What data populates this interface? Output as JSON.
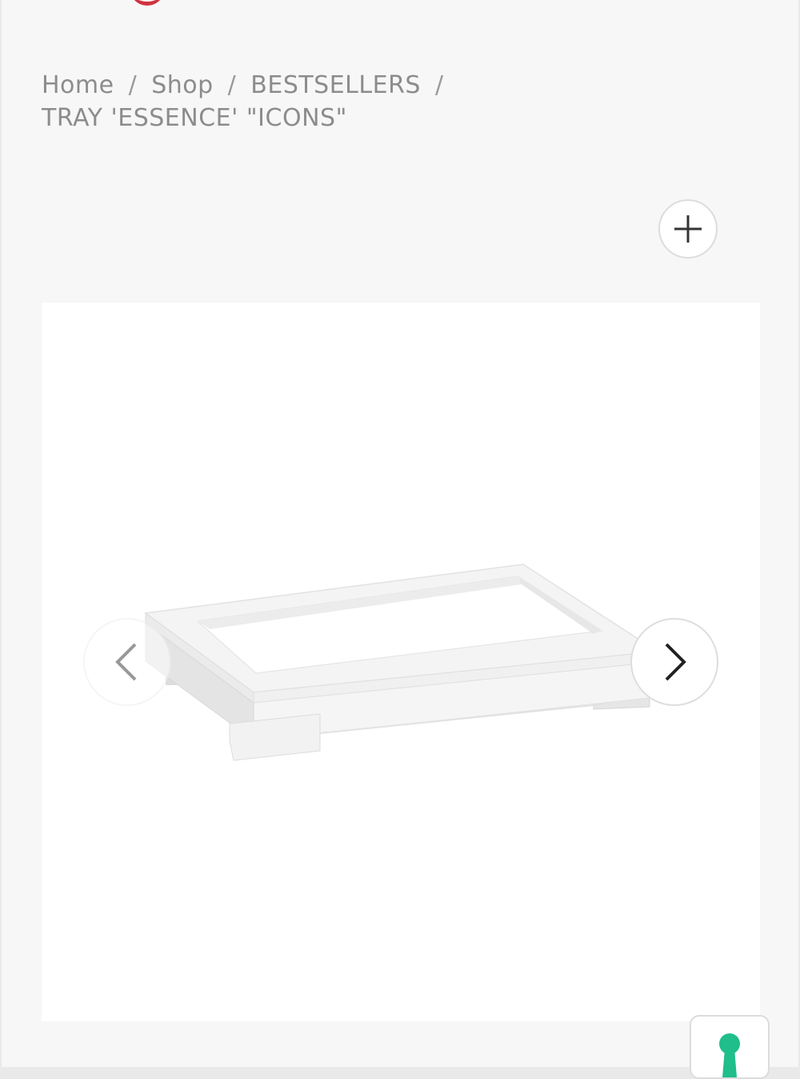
{
  "breadcrumb": {
    "items": [
      "Home",
      "Shop",
      "BESTSELLERS"
    ],
    "separator": "/",
    "current": "TRAY 'ESSENCE' \"ICONS\""
  },
  "icons": {
    "zoom": "plus-icon",
    "prev": "chevron-left-icon",
    "next": "chevron-right-icon",
    "chat": "keyhole-icon"
  },
  "colors": {
    "brand_red": "#d1323f",
    "chat_green": "#1fbe8a",
    "breadcrumb_text": "#8c8c8c"
  }
}
